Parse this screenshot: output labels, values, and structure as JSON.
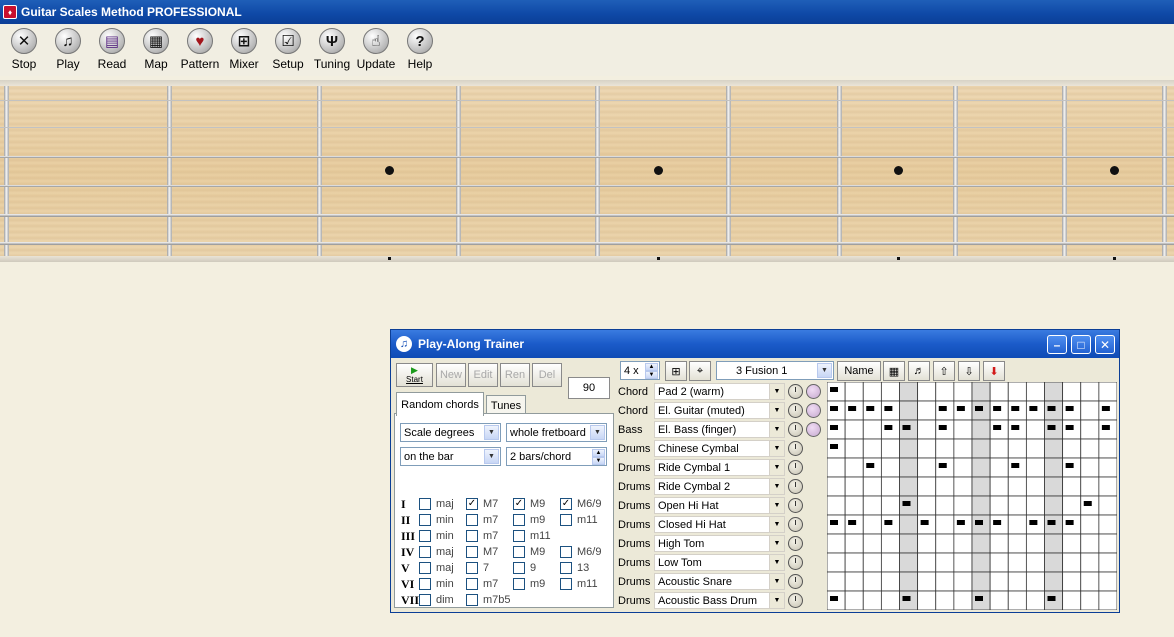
{
  "app": {
    "title": "Guitar Scales Method PROFESSIONAL"
  },
  "toolbar": {
    "items": [
      {
        "label": "Stop",
        "icon": "stop-icon",
        "glyph": "✕"
      },
      {
        "label": "Play",
        "icon": "play-icon",
        "glyph": "♫"
      },
      {
        "label": "Read",
        "icon": "book-icon",
        "glyph": "▤"
      },
      {
        "label": "Map",
        "icon": "map-icon",
        "glyph": "▦"
      },
      {
        "label": "Pattern",
        "icon": "pick-icon",
        "glyph": "♥"
      },
      {
        "label": "Mixer",
        "icon": "mixer-icon",
        "glyph": "⊞"
      },
      {
        "label": "Setup",
        "icon": "setup-icon",
        "glyph": "☑"
      },
      {
        "label": "Tuning",
        "icon": "tuning-fork-icon",
        "glyph": "Ψ"
      },
      {
        "label": "Update",
        "icon": "hand-pointer-icon",
        "glyph": "☝"
      },
      {
        "label": "Help",
        "icon": "help-icon",
        "glyph": "?"
      }
    ]
  },
  "trainer": {
    "title": "Play-Along Trainer",
    "start_label": "Start",
    "buttons": {
      "new": "New",
      "edit": "Edit",
      "ren": "Ren",
      "del": "Del"
    },
    "tempo": "90",
    "tabs": {
      "random": "Random chords",
      "tunes": "Tunes"
    },
    "selects": {
      "scale": "Scale degrees",
      "range": "whole fretboard",
      "timing": "on the bar",
      "bars": "2 bars/chord"
    },
    "degrees": [
      {
        "deg": "I",
        "c": [
          {
            "l": "maj",
            "v": false
          },
          {
            "l": "M7",
            "v": true
          },
          {
            "l": "M9",
            "v": true
          },
          {
            "l": "M6/9",
            "v": true
          }
        ]
      },
      {
        "deg": "II",
        "c": [
          {
            "l": "min",
            "v": false
          },
          {
            "l": "m7",
            "v": false
          },
          {
            "l": "m9",
            "v": false
          },
          {
            "l": "m11",
            "v": false
          }
        ]
      },
      {
        "deg": "III",
        "c": [
          {
            "l": "min",
            "v": false
          },
          {
            "l": "m7",
            "v": false
          },
          {
            "l": "m11",
            "v": false
          }
        ]
      },
      {
        "deg": "IV",
        "c": [
          {
            "l": "maj",
            "v": false
          },
          {
            "l": "M7",
            "v": false
          },
          {
            "l": "M9",
            "v": false
          },
          {
            "l": "M6/9",
            "v": false
          }
        ]
      },
      {
        "deg": "V",
        "c": [
          {
            "l": "maj",
            "v": false
          },
          {
            "l": "7",
            "v": false
          },
          {
            "l": "9",
            "v": false
          },
          {
            "l": "13",
            "v": false
          }
        ]
      },
      {
        "deg": "VI",
        "c": [
          {
            "l": "min",
            "v": false
          },
          {
            "l": "m7",
            "v": false
          },
          {
            "l": "m9",
            "v": false
          },
          {
            "l": "m11",
            "v": false
          }
        ]
      },
      {
        "deg": "VII",
        "c": [
          {
            "l": "dim",
            "v": false
          },
          {
            "l": "m7b5",
            "v": false
          }
        ]
      }
    ],
    "repeat": "4 x",
    "style": "3 Fusion 1",
    "name_button": "Name",
    "tracks": [
      {
        "type": "Chord",
        "instrument": "Pad 2 (warm)"
      },
      {
        "type": "Chord",
        "instrument": "El. Guitar (muted)"
      },
      {
        "type": "Bass",
        "instrument": "El. Bass (finger)"
      },
      {
        "type": "Drums",
        "instrument": "Chinese Cymbal"
      },
      {
        "type": "Drums",
        "instrument": "Ride Cymbal 1"
      },
      {
        "type": "Drums",
        "instrument": "Ride Cymbal 2"
      },
      {
        "type": "Drums",
        "instrument": "Open Hi Hat"
      },
      {
        "type": "Drums",
        "instrument": "Closed Hi Hat"
      },
      {
        "type": "Drums",
        "instrument": "High Tom"
      },
      {
        "type": "Drums",
        "instrument": "Low Tom"
      },
      {
        "type": "Drums",
        "instrument": "Acoustic Snare"
      },
      {
        "type": "Drums",
        "instrument": "Acoustic Bass Drum"
      }
    ],
    "pattern": {
      "steps": 16,
      "shaded_steps": [
        4,
        8,
        12
      ],
      "rows": [
        [
          1,
          0,
          0,
          0,
          0,
          0,
          0,
          0,
          0,
          0,
          0,
          0,
          0,
          0,
          0,
          0
        ],
        [
          1,
          1,
          1,
          1,
          0,
          0,
          1,
          1,
          1,
          1,
          1,
          1,
          1,
          1,
          0,
          1
        ],
        [
          1,
          0,
          0,
          1,
          1,
          0,
          1,
          0,
          0,
          1,
          1,
          0,
          1,
          1,
          0,
          1
        ],
        [
          1,
          0,
          0,
          0,
          0,
          0,
          0,
          0,
          0,
          0,
          0,
          0,
          0,
          0,
          0,
          0
        ],
        [
          0,
          0,
          1,
          0,
          0,
          0,
          1,
          0,
          0,
          0,
          1,
          0,
          0,
          1,
          0,
          0
        ],
        [
          0,
          0,
          0,
          0,
          0,
          0,
          0,
          0,
          0,
          0,
          0,
          0,
          0,
          0,
          0,
          0
        ],
        [
          0,
          0,
          0,
          0,
          1,
          0,
          0,
          0,
          0,
          0,
          0,
          0,
          0,
          0,
          1,
          0
        ],
        [
          1,
          1,
          0,
          1,
          0,
          1,
          0,
          1,
          1,
          1,
          0,
          1,
          1,
          1,
          0,
          0
        ],
        [
          0,
          0,
          0,
          0,
          0,
          0,
          0,
          0,
          0,
          0,
          0,
          0,
          0,
          0,
          0,
          0
        ],
        [
          0,
          0,
          0,
          0,
          0,
          0,
          0,
          0,
          0,
          0,
          0,
          0,
          0,
          0,
          0,
          0
        ],
        [
          0,
          0,
          0,
          0,
          0,
          0,
          0,
          0,
          0,
          0,
          0,
          0,
          0,
          0,
          0,
          0
        ],
        [
          1,
          0,
          0,
          0,
          1,
          0,
          0,
          0,
          1,
          0,
          0,
          0,
          1,
          0,
          0,
          0
        ]
      ]
    }
  }
}
